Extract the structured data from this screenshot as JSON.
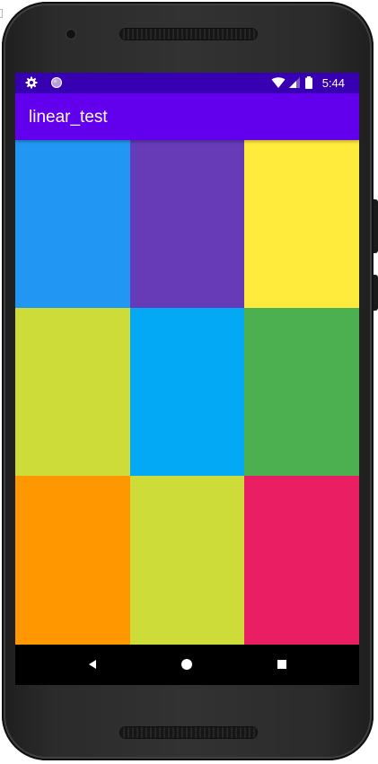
{
  "status_bar": {
    "time": "5:44",
    "left_icons": [
      "settings-gear-icon",
      "notification-dot-icon"
    ],
    "right_icons": [
      "wifi-icon",
      "signal-icon",
      "battery-icon"
    ],
    "color": "#3700b3"
  },
  "app_bar": {
    "title": "linear_test",
    "color": "#6200ee"
  },
  "grid": {
    "rows": [
      [
        "#2196f3",
        "#673ab7",
        "#ffeb3b"
      ],
      [
        "#cddc39",
        "#03a9f4",
        "#4caf50"
      ],
      [
        "#ff9800",
        "#cddc39",
        "#e91e63"
      ]
    ]
  },
  "nav_bar": {
    "buttons": [
      "back-icon",
      "home-icon",
      "recents-icon"
    ]
  }
}
